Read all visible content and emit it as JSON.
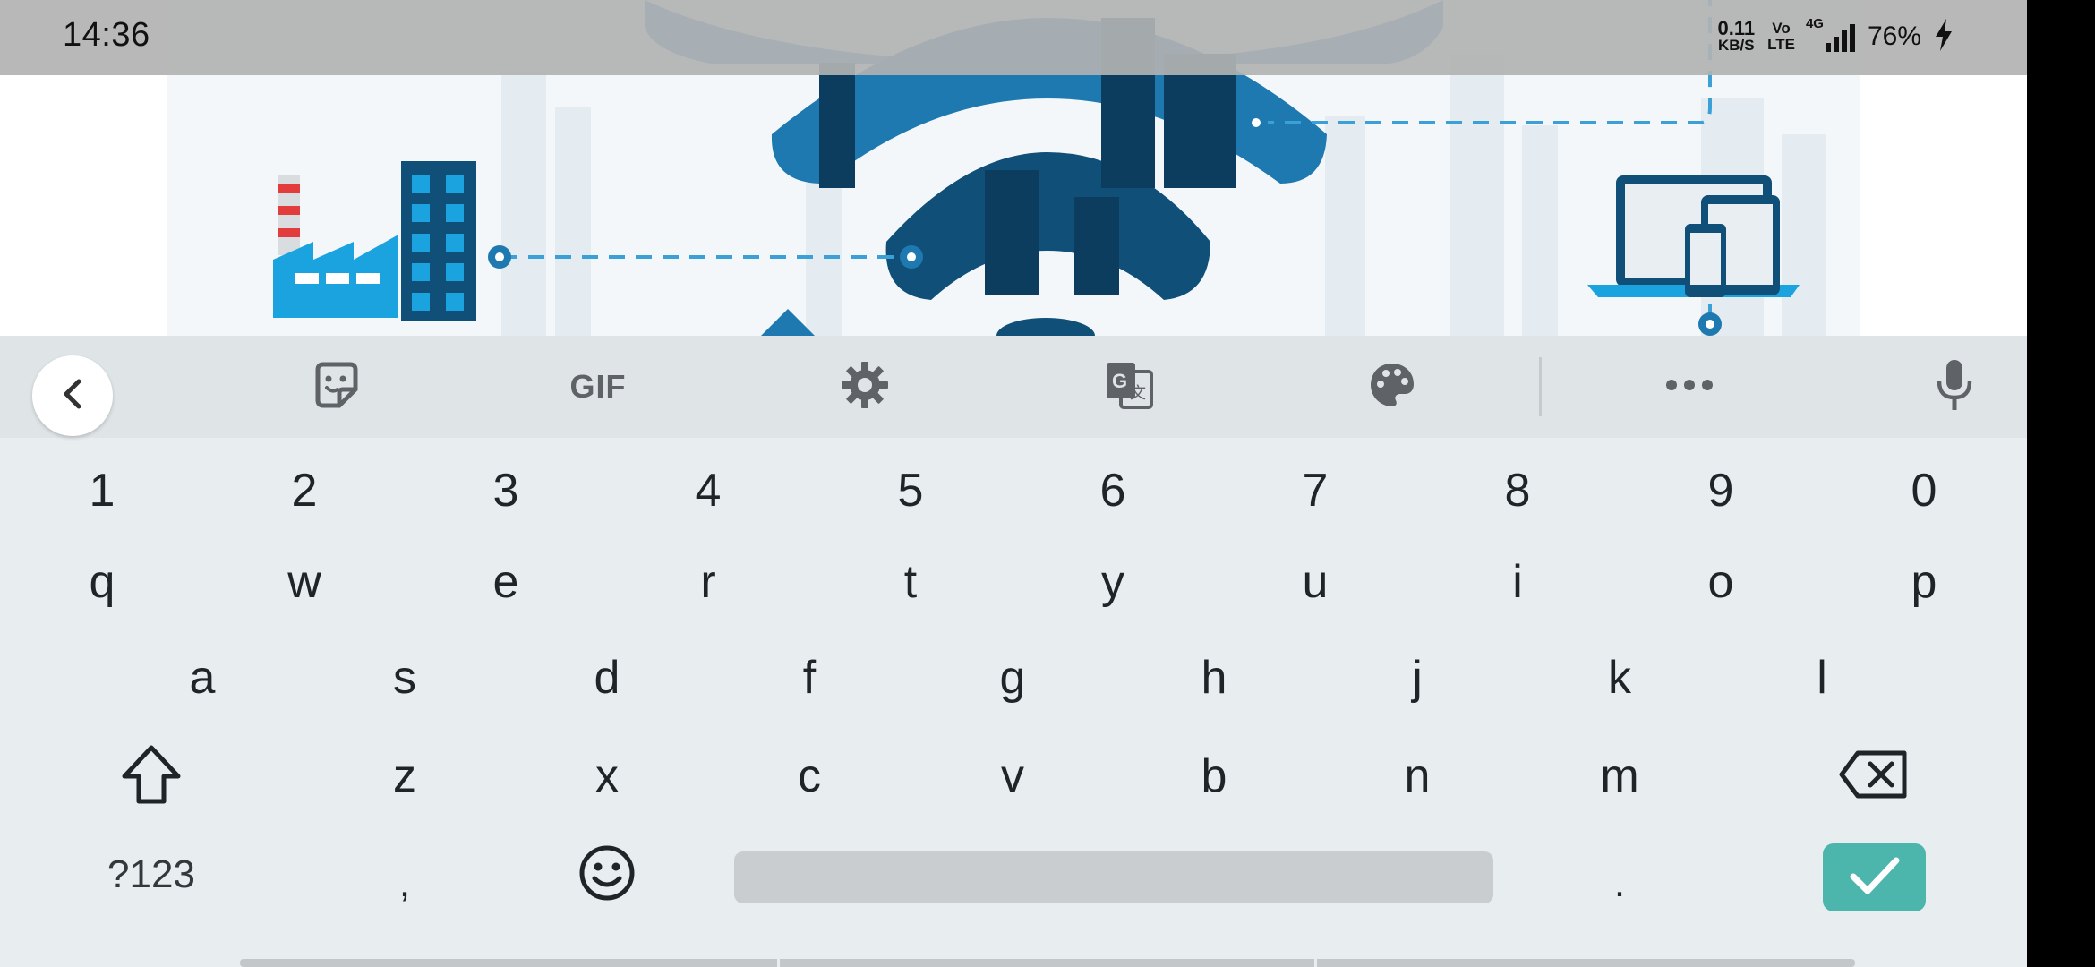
{
  "status_bar": {
    "time": "14:36",
    "net_speed_value": "0.11",
    "net_speed_unit": "KB/S",
    "volte_top": "Vo",
    "volte_bottom": "LTE",
    "network_type": "4G",
    "battery_percent": "76%"
  },
  "toolbar": {
    "gif_label": "GIF",
    "icons": [
      "chevron-left-icon",
      "sticker-icon",
      "gif-icon",
      "gear-icon",
      "translate-icon",
      "palette-icon",
      "more-icon",
      "microphone-icon"
    ]
  },
  "keyboard": {
    "number_row": [
      "1",
      "2",
      "3",
      "4",
      "5",
      "6",
      "7",
      "8",
      "9",
      "0"
    ],
    "row1": [
      "q",
      "w",
      "e",
      "r",
      "t",
      "y",
      "u",
      "i",
      "o",
      "p"
    ],
    "row2": [
      "a",
      "s",
      "d",
      "f",
      "g",
      "h",
      "j",
      "k",
      "l"
    ],
    "row3": [
      "z",
      "x",
      "c",
      "v",
      "b",
      "n",
      "m"
    ],
    "symbols_label": "?123",
    "comma_label": ",",
    "period_label": "."
  },
  "colors": {
    "keyboard_bg": "#e8edf0",
    "toolbar_bg": "#dfe4e7",
    "enter_key": "#4db6ac",
    "illustration_blue": "#1ba3e0",
    "illustration_dark": "#0f4f78"
  }
}
